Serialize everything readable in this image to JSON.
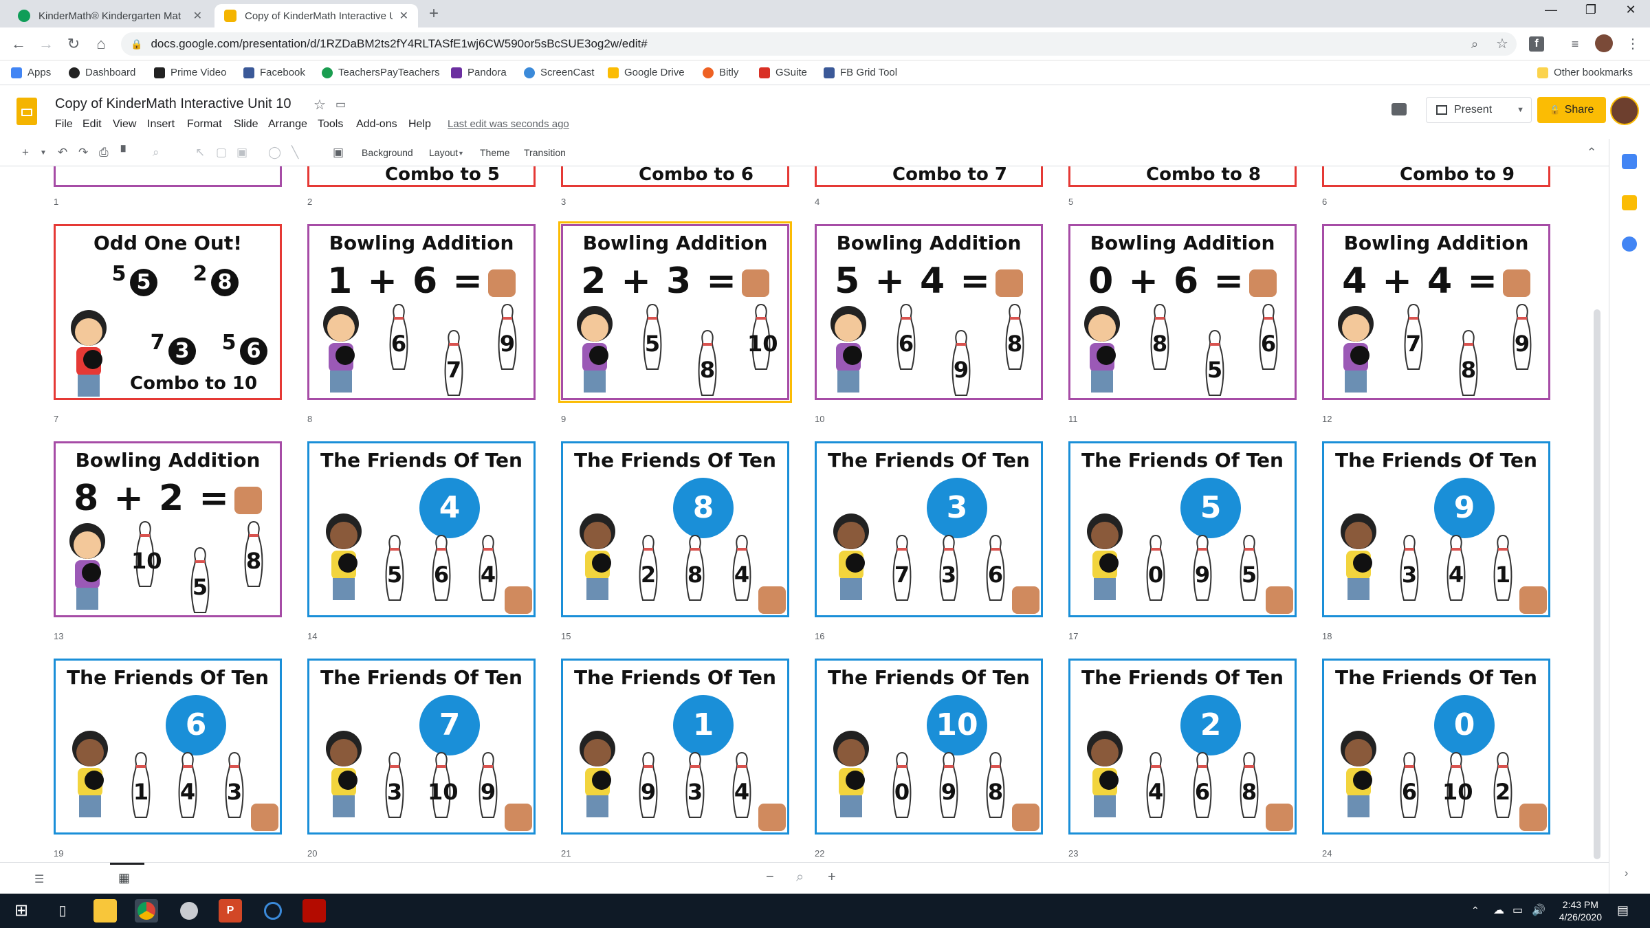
{
  "browser": {
    "tabs": [
      {
        "title": "KinderMath® Kindergarten Mat",
        "active": false,
        "icon_color": "#0f9d58"
      },
      {
        "title": "Copy of KinderMath Interactive U",
        "active": true,
        "icon_color": "#f4b400"
      }
    ],
    "new_tab_label": "+",
    "url": "docs.google.com/presentation/d/1RZDaBM2ts2fY4RLTASfE1wj6CW590or5sBcSUE3og2w/edit#",
    "bookmarks": [
      {
        "label": "Apps",
        "icon_color": "#4285f4"
      },
      {
        "label": "Dashboard",
        "icon_color": "#222222"
      },
      {
        "label": "Prime Video",
        "icon_color": "#222222"
      },
      {
        "label": "Facebook",
        "icon_color": "#3b5998"
      },
      {
        "label": "TeachersPayTeachers",
        "icon_color": "#1a9d50"
      },
      {
        "label": "Pandora",
        "icon_color": "#6b2fa0"
      },
      {
        "label": "ScreenCast",
        "icon_color": "#3b8ad9"
      },
      {
        "label": "Google Drive",
        "icon_color": "#fbbc04"
      },
      {
        "label": "Bitly",
        "icon_color": "#ee6123"
      },
      {
        "label": "GSuite",
        "icon_color": "#d93025"
      },
      {
        "label": "FB Grid Tool",
        "icon_color": "#3b5998"
      }
    ],
    "other_bookmarks": "Other bookmarks"
  },
  "document": {
    "title": "Copy of KinderMath Interactive Unit 10",
    "menu": [
      "File",
      "Edit",
      "View",
      "Insert",
      "Format",
      "Slide",
      "Arrange",
      "Tools",
      "Add-ons",
      "Help"
    ],
    "last_edit": "Last edit was seconds ago",
    "present_label": "Present",
    "share_label": "Share"
  },
  "toolbar": {
    "background_label": "Background",
    "layout_label": "Layout",
    "theme_label": "Theme",
    "transition_label": "Transition"
  },
  "slides": {
    "top_partial": [
      {
        "num": "1",
        "caption": ""
      },
      {
        "num": "2",
        "caption": "Combo to 5"
      },
      {
        "num": "3",
        "caption": "Combo to 6"
      },
      {
        "num": "4",
        "caption": "Combo to 7"
      },
      {
        "num": "5",
        "caption": "Combo to 8"
      },
      {
        "num": "6",
        "caption": "Combo to 9"
      }
    ],
    "row1": [
      {
        "num": "7",
        "title": "Odd One Out!",
        "kind": "odd",
        "pairs": [
          "5",
          "5",
          "2",
          "8",
          "7",
          "3",
          "5",
          "6"
        ],
        "combo": "Combo to 10",
        "border": "#e53935"
      },
      {
        "num": "8",
        "title": "Bowling Addition",
        "kind": "add",
        "equation": "1 + 6 =",
        "pins": [
          "6",
          "7",
          "9"
        ],
        "border": "#a64ca6"
      },
      {
        "num": "9",
        "title": "Bowling Addition",
        "kind": "add",
        "equation": "2 + 3 =",
        "pins": [
          "5",
          "8",
          "10"
        ],
        "border": "#a64ca6"
      },
      {
        "num": "10",
        "title": "Bowling Addition",
        "kind": "add",
        "equation": "5 + 4 =",
        "pins": [
          "6",
          "9",
          "8"
        ],
        "border": "#a64ca6"
      },
      {
        "num": "11",
        "title": "Bowling Addition",
        "kind": "add",
        "equation": "0 + 6 =",
        "pins": [
          "8",
          "5",
          "6"
        ],
        "border": "#a64ca6"
      },
      {
        "num": "12",
        "title": "Bowling Addition",
        "kind": "add",
        "equation": "4 + 4 =",
        "pins": [
          "7",
          "8",
          "9"
        ],
        "border": "#a64ca6"
      }
    ],
    "row2": [
      {
        "num": "13",
        "title": "Bowling Addition",
        "kind": "add",
        "equation": "8 + 2 =",
        "pins": [
          "10",
          "5",
          "8"
        ],
        "border": "#a64ca6"
      },
      {
        "num": "14",
        "title": "The Friends Of Ten",
        "kind": "ten",
        "ball": "4",
        "pins": [
          "5",
          "6",
          "4"
        ],
        "border": "#1a8fd8"
      },
      {
        "num": "15",
        "title": "The Friends Of Ten",
        "kind": "ten",
        "ball": "8",
        "pins": [
          "2",
          "8",
          "4"
        ],
        "border": "#1a8fd8"
      },
      {
        "num": "16",
        "title": "The Friends Of Ten",
        "kind": "ten",
        "ball": "3",
        "pins": [
          "7",
          "3",
          "6"
        ],
        "border": "#1a8fd8"
      },
      {
        "num": "17",
        "title": "The Friends Of Ten",
        "kind": "ten",
        "ball": "5",
        "pins": [
          "0",
          "9",
          "5"
        ],
        "border": "#1a8fd8"
      },
      {
        "num": "18",
        "title": "The Friends Of Ten",
        "kind": "ten",
        "ball": "9",
        "pins": [
          "3",
          "4",
          "1"
        ],
        "border": "#1a8fd8"
      }
    ],
    "row3": [
      {
        "num": "19",
        "title": "The Friends Of Ten",
        "kind": "ten",
        "ball": "6",
        "pins": [
          "1",
          "4",
          "3"
        ],
        "border": "#1a8fd8"
      },
      {
        "num": "20",
        "title": "The Friends Of Ten",
        "kind": "ten",
        "ball": "7",
        "pins": [
          "3",
          "10",
          "9"
        ],
        "border": "#1a8fd8"
      },
      {
        "num": "21",
        "title": "The Friends Of Ten",
        "kind": "ten",
        "ball": "1",
        "pins": [
          "9",
          "3",
          "4"
        ],
        "border": "#1a8fd8"
      },
      {
        "num": "22",
        "title": "The Friends Of Ten",
        "kind": "ten",
        "ball": "10",
        "pins": [
          "0",
          "9",
          "8"
        ],
        "border": "#1a8fd8"
      },
      {
        "num": "23",
        "title": "The Friends Of Ten",
        "kind": "ten",
        "ball": "2",
        "pins": [
          "4",
          "6",
          "8"
        ],
        "border": "#1a8fd8"
      },
      {
        "num": "24",
        "title": "The Friends Of Ten",
        "kind": "ten",
        "ball": "0",
        "pins": [
          "6",
          "10",
          "2"
        ],
        "border": "#1a8fd8"
      }
    ]
  },
  "taskbar": {
    "time": "2:43 PM",
    "date": "4/26/2020"
  },
  "colors": {
    "accent_yellow": "#fbbc04",
    "selected_outline": "#fbbc04"
  }
}
